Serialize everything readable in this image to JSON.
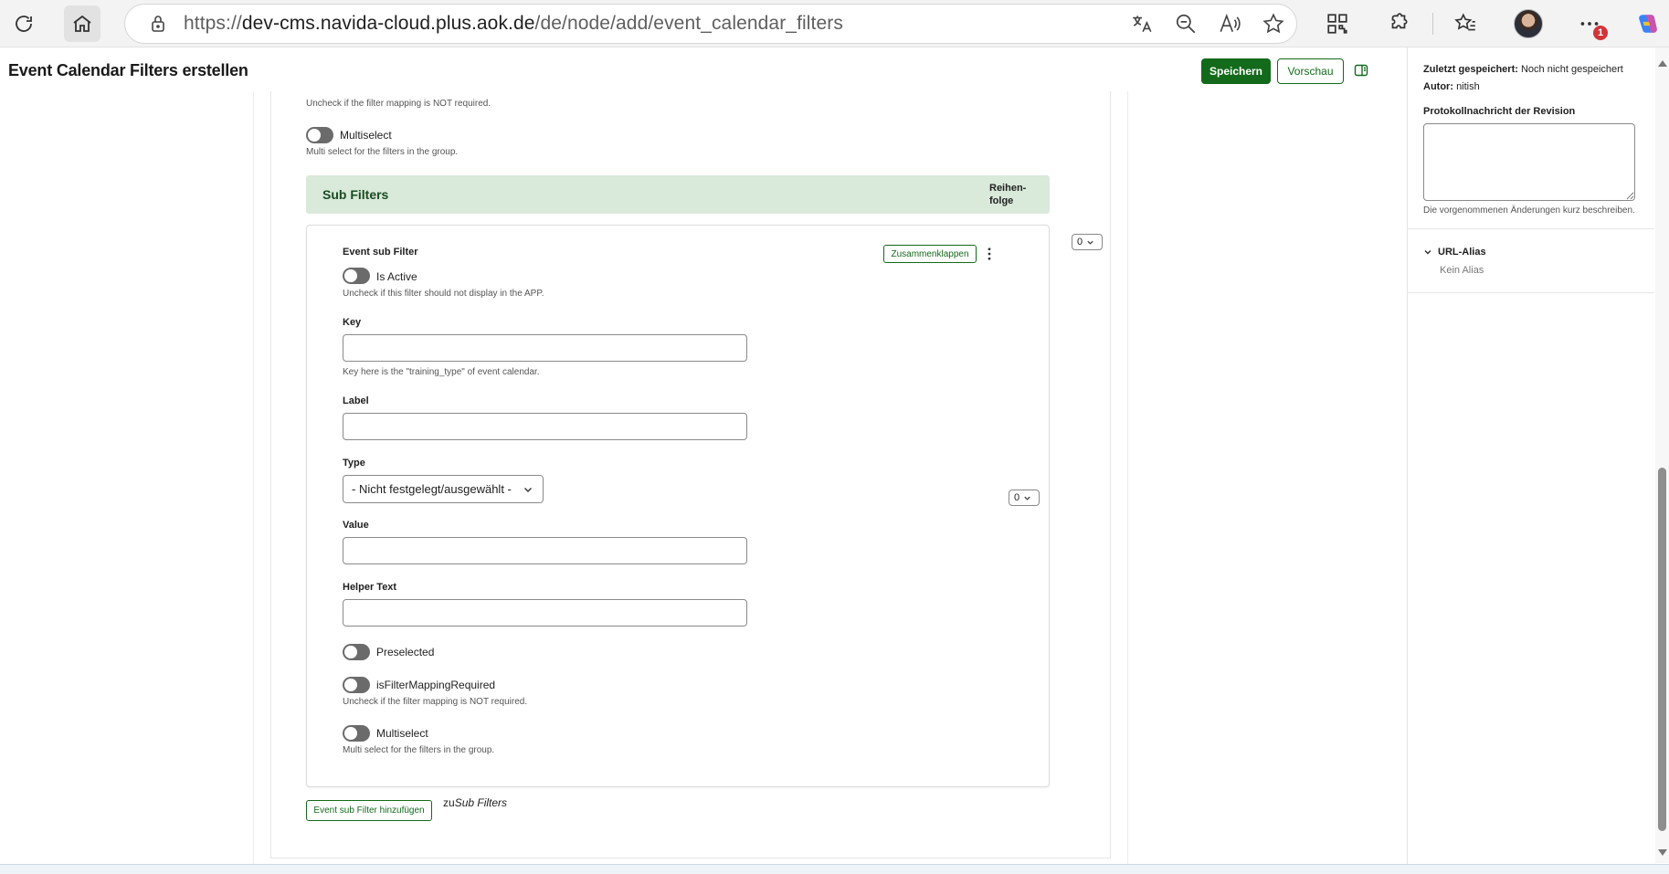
{
  "browser": {
    "url_scheme": "https://",
    "url_host": "dev-cms.navida-cloud.plus.aok.de",
    "url_path": "/de/node/add/event_calendar_filters",
    "notification_count": "1"
  },
  "header": {
    "title": "Event Calendar Filters erstellen",
    "save_label": "Speichern",
    "preview_label": "Vorschau"
  },
  "top_group": {
    "mapping_help": "Uncheck if the filter mapping is NOT required.",
    "multiselect_label": "Multiselect",
    "multiselect_help": "Multi select for the filters in the group."
  },
  "sub_filters": {
    "title": "Sub Filters",
    "order_label": "Reihen-folge",
    "weight_top": "0",
    "weight_item": "0",
    "item": {
      "title": "Event sub Filter",
      "collapse_label": "Zusammenklappen",
      "is_active_label": "Is Active",
      "is_active_help": "Uncheck if this filter should not display in the APP.",
      "key_label": "Key",
      "key_value": "",
      "key_help": "Key here is the \"training_type\" of event calendar.",
      "label_label": "Label",
      "label_value": "",
      "type_label": "Type",
      "type_selected": "- Nicht festgelegt/ausgewählt -",
      "value_label": "Value",
      "value_value": "",
      "helper_label": "Helper Text",
      "helper_value": "",
      "preselected_label": "Preselected",
      "mapping_label": "isFilterMappingRequired",
      "mapping_help": "Uncheck if the filter mapping is NOT required.",
      "multiselect_label": "Multiselect",
      "multiselect_help": "Multi select for the filters in the group."
    },
    "add_button_label": "Event sub Filter hinzufügen",
    "add_suffix_prefix": "zu",
    "add_suffix_target": "Sub Filters"
  },
  "sidebar": {
    "last_saved_label": "Zuletzt gespeichert:",
    "last_saved_value": "Noch nicht gespeichert",
    "author_label": "Autor:",
    "author_value": "nitish",
    "revision_label": "Protokollnachricht der Revision",
    "revision_help": "Die vorgenommenen Änderungen kurz beschreiben.",
    "url_alias_label": "URL-Alias",
    "url_alias_value": "Kein Alias"
  },
  "colors": {
    "primary_green": "#136a1b",
    "section_header_bg": "#d9e9da",
    "toggle_off": "#6b6b6b"
  },
  "icons": {
    "reload": "reload-icon",
    "home": "home-icon",
    "lock": "lock-icon",
    "translate": "translate-icon",
    "zoom_out": "zoom-out-icon",
    "read_aloud": "read-aloud-icon",
    "favorite": "star-icon",
    "qr": "qr-code-icon",
    "extensions": "puzzle-icon",
    "favorites_bar": "favorites-icon",
    "more": "more-icon",
    "copilot": "copilot-icon"
  }
}
